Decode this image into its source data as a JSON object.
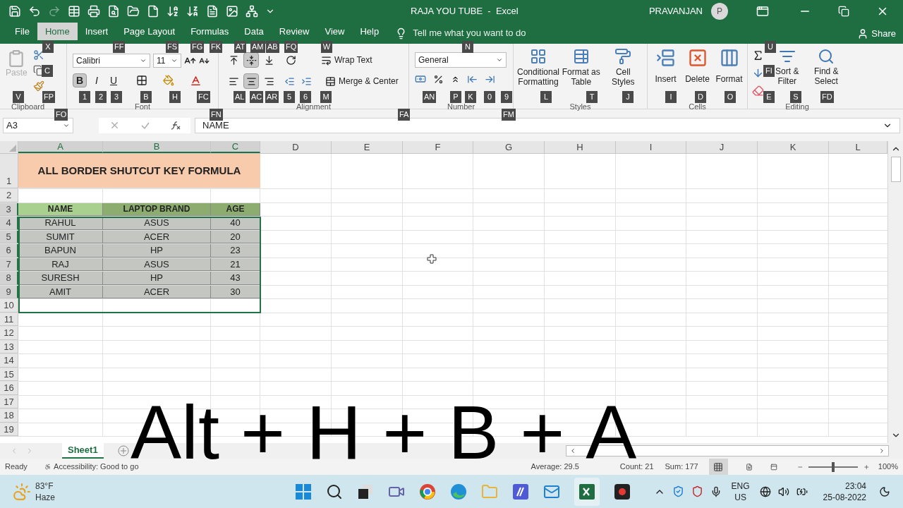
{
  "window": {
    "title": "RAJA YOU TUBE  -  Excel",
    "user": "PRAVANJAN",
    "avatar": "P"
  },
  "quick_access": {
    "redo_disabled": true
  },
  "ribbon_tabs": [
    {
      "label": "File",
      "selected": false
    },
    {
      "label": "Home",
      "selected": true
    },
    {
      "label": "Insert",
      "selected": false
    },
    {
      "label": "Page Layout",
      "selected": false
    },
    {
      "label": "Formulas",
      "selected": false
    },
    {
      "label": "Data",
      "selected": false
    },
    {
      "label": "Review",
      "selected": false
    },
    {
      "label": "View",
      "selected": false
    },
    {
      "label": "Help",
      "selected": false
    }
  ],
  "tell_me": "Tell me what you want to do",
  "share": "Share",
  "clipboard": {
    "label": "Clipboard",
    "paste": "Paste",
    "paste_disabled": true
  },
  "font": {
    "label": "Font",
    "name": "Calibri",
    "size": "11",
    "styles": [
      {
        "text": "B",
        "selected": true
      },
      {
        "text": "I",
        "selected": false
      },
      {
        "text": "U",
        "selected": false
      }
    ]
  },
  "alignment": {
    "label": "Alignment",
    "wrap_text": "Wrap Text",
    "merge": "Merge & Center",
    "vertical": [
      {
        "kind": "top",
        "selected": false
      },
      {
        "kind": "middle",
        "selected": true
      },
      {
        "kind": "bottom",
        "selected": false
      }
    ],
    "horizontal": [
      {
        "kind": "left",
        "selected": false
      },
      {
        "kind": "center",
        "selected": true
      },
      {
        "kind": "right",
        "selected": false
      }
    ]
  },
  "number": {
    "label": "Number",
    "format": "General"
  },
  "styles": {
    "label": "Styles",
    "buttons": [
      "Conditional Formatting",
      "Format as Table",
      "Cell Styles"
    ]
  },
  "cells": {
    "label": "Cells",
    "buttons": [
      "Insert",
      "Delete",
      "Format"
    ]
  },
  "editing": {
    "label": "Editing",
    "buttons": [
      "Sort & Filter",
      "Find & Select"
    ]
  },
  "keytips": [
    "X",
    "FF",
    "FS",
    "FG",
    "FK",
    "AT",
    "AM",
    "AB",
    "FQ",
    "W",
    "N",
    "U",
    "C",
    "FI",
    "V",
    "FP",
    "1",
    "2",
    "3",
    "B",
    "H",
    "FC",
    "AL",
    "AC",
    "AR",
    "5",
    "6",
    "M",
    "AN",
    "P",
    "K",
    "0",
    "9",
    "L",
    "T",
    "J",
    "I",
    "D",
    "O",
    "E",
    "S",
    "FD",
    "FO",
    "FN",
    "FA",
    "FM"
  ],
  "formula_bar": {
    "name_box": "A3",
    "formula": "NAME"
  },
  "columns": [
    {
      "label": "A",
      "selected": true
    },
    {
      "label": "B",
      "selected": true
    },
    {
      "label": "C",
      "selected": true
    },
    {
      "label": "D",
      "selected": false
    },
    {
      "label": "E",
      "selected": false
    },
    {
      "label": "F",
      "selected": false
    },
    {
      "label": "G",
      "selected": false
    },
    {
      "label": "H",
      "selected": false
    },
    {
      "label": "I",
      "selected": false
    },
    {
      "label": "J",
      "selected": false
    },
    {
      "label": "K",
      "selected": false
    },
    {
      "label": "L",
      "selected": false
    }
  ],
  "rows": [
    {
      "label": "1",
      "selected": false
    },
    {
      "label": "2",
      "selected": false
    },
    {
      "label": "3",
      "selected": true
    },
    {
      "label": "4",
      "selected": true
    },
    {
      "label": "5",
      "selected": true
    },
    {
      "label": "6",
      "selected": true
    },
    {
      "label": "7",
      "selected": true
    },
    {
      "label": "8",
      "selected": true
    },
    {
      "label": "9",
      "selected": true
    },
    {
      "label": "10",
      "selected": false
    },
    {
      "label": "11",
      "selected": false
    },
    {
      "label": "12",
      "selected": false
    },
    {
      "label": "13",
      "selected": false
    },
    {
      "label": "14",
      "selected": false
    },
    {
      "label": "15",
      "selected": false
    },
    {
      "label": "16",
      "selected": false
    },
    {
      "label": "17",
      "selected": false
    },
    {
      "label": "18",
      "selected": false
    },
    {
      "label": "19",
      "selected": false
    }
  ],
  "title": "ALL BORDER SHUTCUT KEY FORMULA",
  "table": {
    "header": [
      {
        "text": "NAME",
        "selected": true
      },
      {
        "text": "LAPTOP BRAND",
        "selected": false
      },
      {
        "text": "AGE",
        "selected": false
      }
    ],
    "rows": [
      [
        "RAHUL",
        "ASUS",
        "40"
      ],
      [
        "SUMIT",
        "ACER",
        "20"
      ],
      [
        "BAPUN",
        "HP",
        "23"
      ],
      [
        "RAJ",
        "ASUS",
        "21"
      ],
      [
        "SURESH",
        "HP",
        "43"
      ],
      [
        "AMIT",
        "ACER",
        "30"
      ]
    ]
  },
  "sheets": [
    {
      "label": "Sheet1",
      "selected": true
    }
  ],
  "status": {
    "mode": "Ready",
    "accessibility": "Accessibility: Good to go",
    "average": "Average: 29.5",
    "count": "Count: 21",
    "sum": "Sum: 177",
    "zoom": "100%"
  },
  "zoom_slider": {
    "level": 0.5
  },
  "overlay_keys": [
    "Alt",
    "+",
    "H",
    "+",
    "B",
    "+",
    "A"
  ],
  "taskbar": {
    "temperature": "83°F",
    "weather": "Haze",
    "language": "ENG",
    "region": "US",
    "time": "23:04",
    "date": "25-08-2022"
  }
}
